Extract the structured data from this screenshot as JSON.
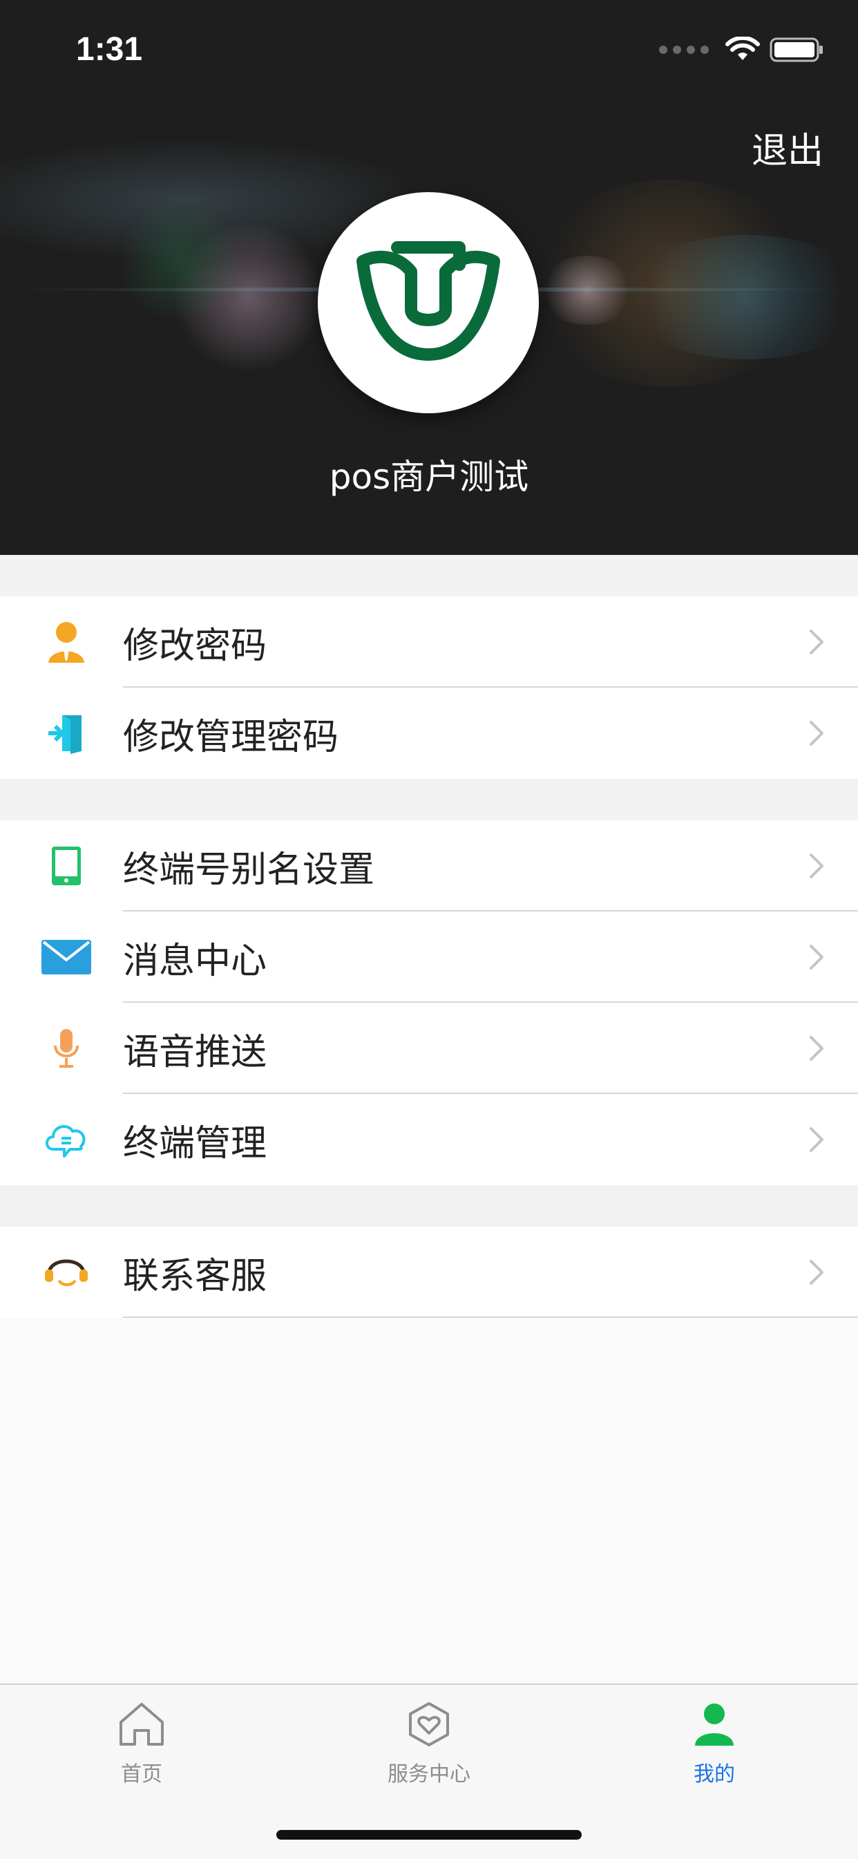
{
  "status_bar": {
    "time": "1:31"
  },
  "header": {
    "logout_label": "退出",
    "merchant_name": "pos商户测试",
    "logo_color": "#0a6b3a"
  },
  "menu": {
    "group1": [
      {
        "label": "修改密码",
        "icon": "user-icon",
        "color": "#f5a623"
      },
      {
        "label": "修改管理密码",
        "icon": "door-enter-icon",
        "color": "#1ec8e8"
      }
    ],
    "group2": [
      {
        "label": "终端号别名设置",
        "icon": "tablet-icon",
        "color": "#22c16b"
      },
      {
        "label": "消息中心",
        "icon": "mail-icon",
        "color": "#2a9fde"
      },
      {
        "label": "语音推送",
        "icon": "microphone-icon",
        "color": "#f5a05a"
      },
      {
        "label": "终端管理",
        "icon": "cloud-chat-icon",
        "color": "#1ec8e8"
      }
    ],
    "group3": [
      {
        "label": "联系客服",
        "icon": "headset-icon",
        "color": "#f5a623"
      }
    ]
  },
  "tabbar": {
    "tabs": [
      {
        "label": "首页",
        "icon": "home-icon",
        "active": false
      },
      {
        "label": "服务中心",
        "icon": "service-heart-icon",
        "active": false
      },
      {
        "label": "我的",
        "icon": "profile-icon",
        "active": true
      }
    ],
    "active_color": "#1a73e8",
    "active_icon_color": "#14b850"
  }
}
